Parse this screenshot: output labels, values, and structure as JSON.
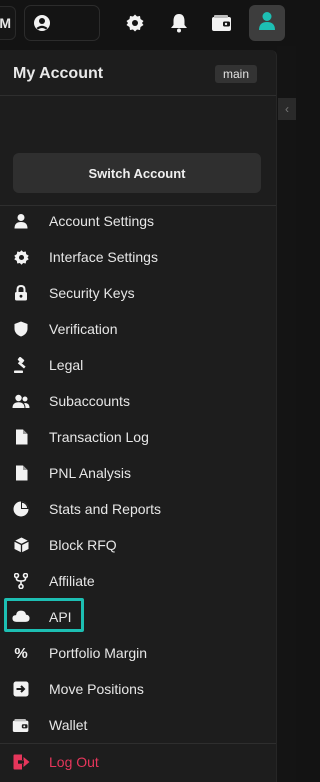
{
  "topbar": {
    "letter": "M",
    "icons": [
      "user-circle-icon",
      "gear-icon",
      "bell-icon",
      "wallet-icon",
      "avatar-icon"
    ]
  },
  "panel": {
    "title": "My Account",
    "badge": "main",
    "switch_label": "Switch Account",
    "menu": [
      {
        "label": "Account Settings",
        "icon": "user-icon"
      },
      {
        "label": "Interface Settings",
        "icon": "gear-icon"
      },
      {
        "label": "Security Keys",
        "icon": "lock-icon"
      },
      {
        "label": "Verification",
        "icon": "shield-icon"
      },
      {
        "label": "Legal",
        "icon": "gavel-icon"
      },
      {
        "label": "Subaccounts",
        "icon": "users-icon"
      },
      {
        "label": "Transaction Log",
        "icon": "file-icon"
      },
      {
        "label": "PNL Analysis",
        "icon": "file-icon"
      },
      {
        "label": "Stats and Reports",
        "icon": "pie-chart-icon"
      },
      {
        "label": "Block RFQ",
        "icon": "cube-icon"
      },
      {
        "label": "Affiliate",
        "icon": "fork-icon"
      },
      {
        "label": "API",
        "icon": "cloud-icon"
      },
      {
        "label": "Portfolio Margin",
        "icon": "percent-icon"
      },
      {
        "label": "Move Positions",
        "icon": "move-icon"
      },
      {
        "label": "Wallet",
        "icon": "wallet-icon"
      }
    ],
    "logout": {
      "label": "Log Out",
      "icon": "logout-icon"
    }
  },
  "colors": {
    "accent": "#1dbfb3",
    "danger": "#e6365b",
    "panel_bg": "#1d1d1d"
  }
}
